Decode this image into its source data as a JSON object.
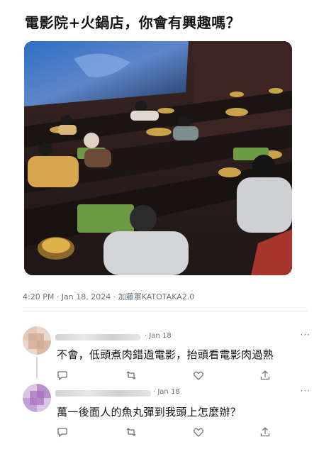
{
  "post": {
    "title": "電影院+火鍋店，你會有興趣嗎？",
    "meta": "4:20 PM · Jan 18, 2024 · 加藤軍KATOTAKA2.0"
  },
  "replies": [
    {
      "date": "· Jan 18",
      "text": "不會，低頭煮肉錯過電影，抬頭看電影肉過熟",
      "more": "···"
    },
    {
      "date": "· Jan 18",
      "text": "萬一後面人的魚丸彈到我頭上怎麼辦？",
      "more": "···"
    }
  ],
  "icons": [
    "more-icon",
    "reply-icon",
    "retweet-icon",
    "like-icon",
    "share-icon"
  ]
}
